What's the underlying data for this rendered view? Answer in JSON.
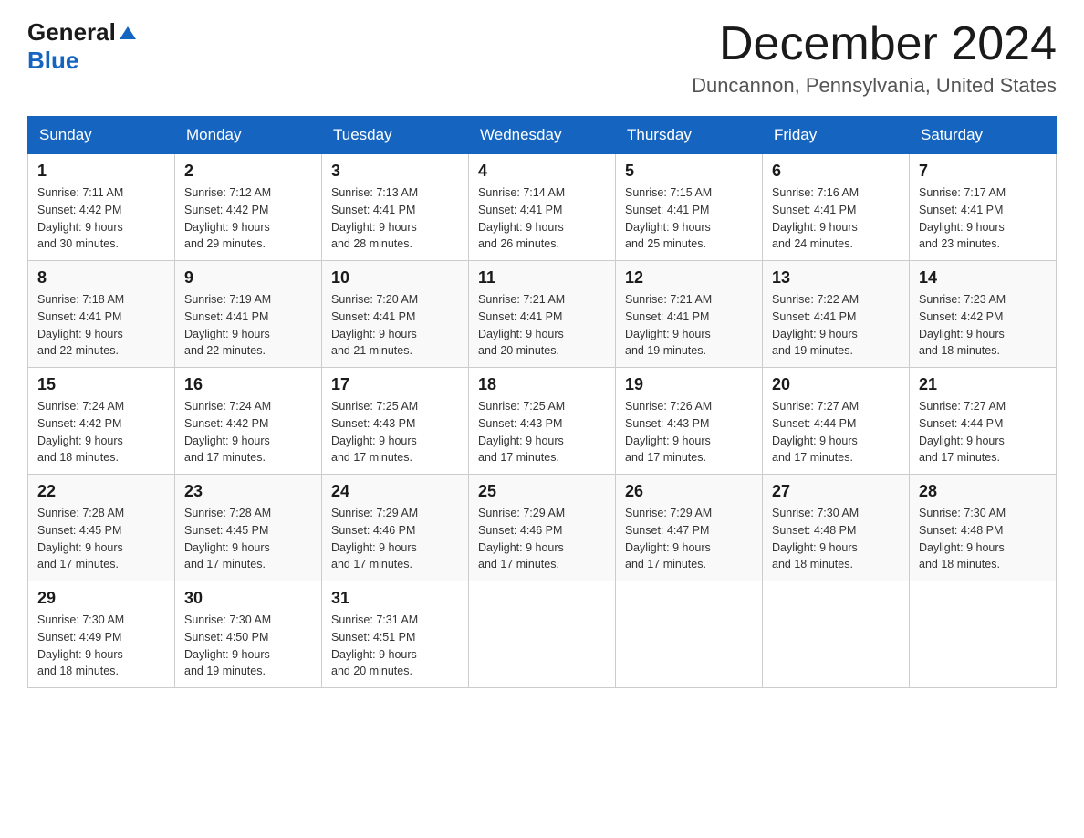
{
  "header": {
    "logo_general": "General",
    "logo_blue": "Blue",
    "title": "December 2024",
    "subtitle": "Duncannon, Pennsylvania, United States"
  },
  "weekdays": [
    "Sunday",
    "Monday",
    "Tuesday",
    "Wednesday",
    "Thursday",
    "Friday",
    "Saturday"
  ],
  "weeks": [
    [
      {
        "day": "1",
        "sunrise": "7:11 AM",
        "sunset": "4:42 PM",
        "daylight": "9 hours and 30 minutes."
      },
      {
        "day": "2",
        "sunrise": "7:12 AM",
        "sunset": "4:42 PM",
        "daylight": "9 hours and 29 minutes."
      },
      {
        "day": "3",
        "sunrise": "7:13 AM",
        "sunset": "4:41 PM",
        "daylight": "9 hours and 28 minutes."
      },
      {
        "day": "4",
        "sunrise": "7:14 AM",
        "sunset": "4:41 PM",
        "daylight": "9 hours and 26 minutes."
      },
      {
        "day": "5",
        "sunrise": "7:15 AM",
        "sunset": "4:41 PM",
        "daylight": "9 hours and 25 minutes."
      },
      {
        "day": "6",
        "sunrise": "7:16 AM",
        "sunset": "4:41 PM",
        "daylight": "9 hours and 24 minutes."
      },
      {
        "day": "7",
        "sunrise": "7:17 AM",
        "sunset": "4:41 PM",
        "daylight": "9 hours and 23 minutes."
      }
    ],
    [
      {
        "day": "8",
        "sunrise": "7:18 AM",
        "sunset": "4:41 PM",
        "daylight": "9 hours and 22 minutes."
      },
      {
        "day": "9",
        "sunrise": "7:19 AM",
        "sunset": "4:41 PM",
        "daylight": "9 hours and 22 minutes."
      },
      {
        "day": "10",
        "sunrise": "7:20 AM",
        "sunset": "4:41 PM",
        "daylight": "9 hours and 21 minutes."
      },
      {
        "day": "11",
        "sunrise": "7:21 AM",
        "sunset": "4:41 PM",
        "daylight": "9 hours and 20 minutes."
      },
      {
        "day": "12",
        "sunrise": "7:21 AM",
        "sunset": "4:41 PM",
        "daylight": "9 hours and 19 minutes."
      },
      {
        "day": "13",
        "sunrise": "7:22 AM",
        "sunset": "4:41 PM",
        "daylight": "9 hours and 19 minutes."
      },
      {
        "day": "14",
        "sunrise": "7:23 AM",
        "sunset": "4:42 PM",
        "daylight": "9 hours and 18 minutes."
      }
    ],
    [
      {
        "day": "15",
        "sunrise": "7:24 AM",
        "sunset": "4:42 PM",
        "daylight": "9 hours and 18 minutes."
      },
      {
        "day": "16",
        "sunrise": "7:24 AM",
        "sunset": "4:42 PM",
        "daylight": "9 hours and 17 minutes."
      },
      {
        "day": "17",
        "sunrise": "7:25 AM",
        "sunset": "4:43 PM",
        "daylight": "9 hours and 17 minutes."
      },
      {
        "day": "18",
        "sunrise": "7:25 AM",
        "sunset": "4:43 PM",
        "daylight": "9 hours and 17 minutes."
      },
      {
        "day": "19",
        "sunrise": "7:26 AM",
        "sunset": "4:43 PM",
        "daylight": "9 hours and 17 minutes."
      },
      {
        "day": "20",
        "sunrise": "7:27 AM",
        "sunset": "4:44 PM",
        "daylight": "9 hours and 17 minutes."
      },
      {
        "day": "21",
        "sunrise": "7:27 AM",
        "sunset": "4:44 PM",
        "daylight": "9 hours and 17 minutes."
      }
    ],
    [
      {
        "day": "22",
        "sunrise": "7:28 AM",
        "sunset": "4:45 PM",
        "daylight": "9 hours and 17 minutes."
      },
      {
        "day": "23",
        "sunrise": "7:28 AM",
        "sunset": "4:45 PM",
        "daylight": "9 hours and 17 minutes."
      },
      {
        "day": "24",
        "sunrise": "7:29 AM",
        "sunset": "4:46 PM",
        "daylight": "9 hours and 17 minutes."
      },
      {
        "day": "25",
        "sunrise": "7:29 AM",
        "sunset": "4:46 PM",
        "daylight": "9 hours and 17 minutes."
      },
      {
        "day": "26",
        "sunrise": "7:29 AM",
        "sunset": "4:47 PM",
        "daylight": "9 hours and 17 minutes."
      },
      {
        "day": "27",
        "sunrise": "7:30 AM",
        "sunset": "4:48 PM",
        "daylight": "9 hours and 18 minutes."
      },
      {
        "day": "28",
        "sunrise": "7:30 AM",
        "sunset": "4:48 PM",
        "daylight": "9 hours and 18 minutes."
      }
    ],
    [
      {
        "day": "29",
        "sunrise": "7:30 AM",
        "sunset": "4:49 PM",
        "daylight": "9 hours and 18 minutes."
      },
      {
        "day": "30",
        "sunrise": "7:30 AM",
        "sunset": "4:50 PM",
        "daylight": "9 hours and 19 minutes."
      },
      {
        "day": "31",
        "sunrise": "7:31 AM",
        "sunset": "4:51 PM",
        "daylight": "9 hours and 20 minutes."
      },
      null,
      null,
      null,
      null
    ]
  ],
  "labels": {
    "sunrise": "Sunrise:",
    "sunset": "Sunset:",
    "daylight": "Daylight:"
  }
}
